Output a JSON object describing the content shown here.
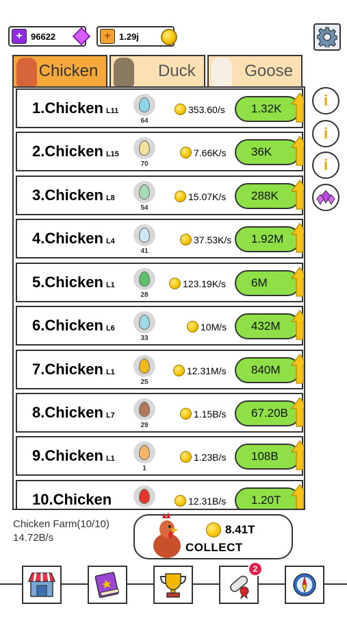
{
  "currency": {
    "gems": "96622",
    "gold": "1.29j"
  },
  "tabs": [
    {
      "label": "Chicken",
      "active": true
    },
    {
      "label": "Duck",
      "active": false
    },
    {
      "label": "Goose",
      "active": false
    }
  ],
  "rows": [
    {
      "name": "1.Chicken",
      "level": "L11",
      "eggs": "64",
      "rate": "353.60/s",
      "price": "1.32K",
      "egg_color": "#8fd6e8"
    },
    {
      "name": "2.Chicken",
      "level": "L15",
      "eggs": "70",
      "rate": "7.66K/s",
      "price": "36K",
      "egg_color": "#f2e29a"
    },
    {
      "name": "3.Chicken",
      "level": "L8",
      "eggs": "54",
      "rate": "15.07K/s",
      "price": "288K",
      "egg_color": "#a7dbb4"
    },
    {
      "name": "4.Chicken",
      "level": "L4",
      "eggs": "41",
      "rate": "37.53K/s",
      "price": "1.92M",
      "egg_color": "#cfe6f7"
    },
    {
      "name": "5.Chicken",
      "level": "L1",
      "eggs": "28",
      "rate": "123.19K/s",
      "price": "6M",
      "egg_color": "#5cc36a"
    },
    {
      "name": "6.Chicken",
      "level": "L6",
      "eggs": "33",
      "rate": "10M/s",
      "price": "432M",
      "egg_color": "#9fd8e6"
    },
    {
      "name": "7.Chicken",
      "level": "L1",
      "eggs": "25",
      "rate": "12.31M/s",
      "price": "840M",
      "egg_color": "#f2b81e"
    },
    {
      "name": "8.Chicken",
      "level": "L7",
      "eggs": "29",
      "rate": "1.15B/s",
      "price": "67.20B",
      "egg_color": "#b07a5a"
    },
    {
      "name": "9.Chicken",
      "level": "L1",
      "eggs": "1",
      "rate": "1.23B/s",
      "price": "108B",
      "egg_color": "#f6b46a"
    },
    {
      "name": "10.Chicken",
      "level": "",
      "eggs": "",
      "rate": "12.31B/s",
      "price": "1.20T",
      "egg_color": "#e8352a"
    }
  ],
  "farm": {
    "name": "Chicken Farm(10/10)",
    "rate": "14.72B/s"
  },
  "collect": {
    "amount": "8.41T",
    "label": "COLLECT"
  },
  "nav": {
    "badge_count": "2",
    "items": [
      "shop-icon",
      "book-icon",
      "trophy-icon",
      "scroll-icon",
      "compass-icon"
    ]
  },
  "colors": {
    "tab_active": "#f6a93a",
    "tab_inactive": "#fbe0b4",
    "buy_button": "#8ee046",
    "coin": "#f4c400",
    "badge": "#e0224e"
  }
}
